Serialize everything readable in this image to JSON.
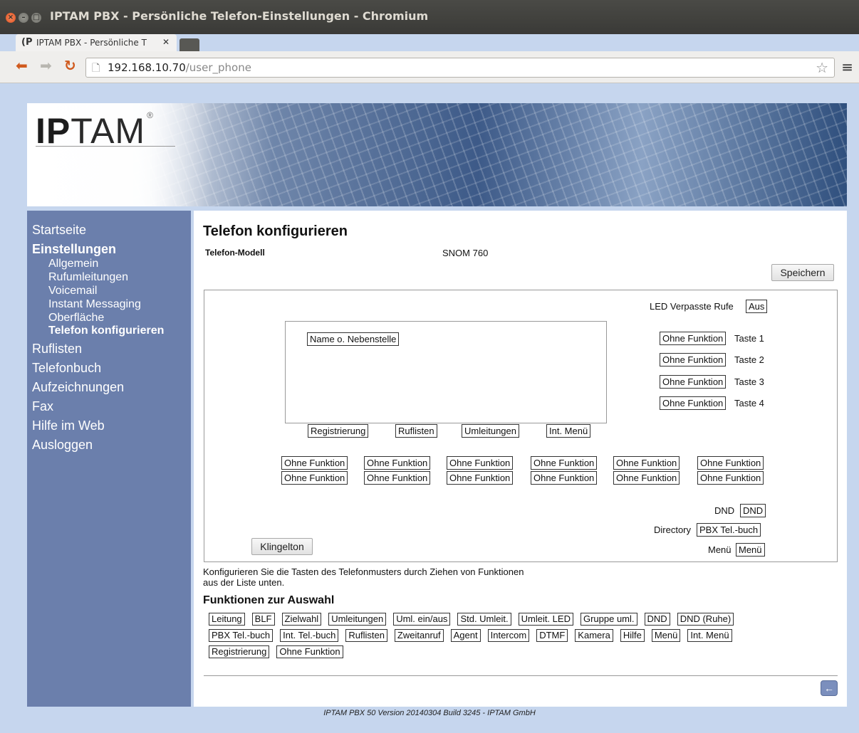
{
  "window": {
    "title": "IPTAM PBX - Persönliche Telefon-Einstellungen - Chromium"
  },
  "tab": {
    "favicon": "(P",
    "title": "IPTAM PBX - Persönliche T"
  },
  "browser": {
    "url_host": "192.168.10.70",
    "url_path": "/user_phone"
  },
  "logo": {
    "text_bold": "IP",
    "text_light": "TAM",
    "mark": "®"
  },
  "sidebar": {
    "items": [
      {
        "label": "Startseite"
      },
      {
        "label": "Einstellungen"
      },
      {
        "label": "Allgemein"
      },
      {
        "label": "Rufumleitungen"
      },
      {
        "label": "Voicemail"
      },
      {
        "label": "Instant Messaging"
      },
      {
        "label": "Oberfläche"
      },
      {
        "label": "Telefon konfigurieren"
      },
      {
        "label": "Ruflisten"
      },
      {
        "label": "Telefonbuch"
      },
      {
        "label": "Aufzeichnungen"
      },
      {
        "label": "Fax"
      },
      {
        "label": "Hilfe im Web"
      },
      {
        "label": "Ausloggen"
      }
    ]
  },
  "main": {
    "title": "Telefon konfigurieren",
    "model_label": "Telefon-Modell",
    "model_value": "SNOM 760",
    "save_label": "Speichern",
    "led_label": "LED Verpasste Rufe",
    "led_value": "Aus",
    "display_name": "Name o. Nebenstelle",
    "side_keys": [
      {
        "func": "Ohne Funktion",
        "label": "Taste 1"
      },
      {
        "func": "Ohne Funktion",
        "label": "Taste 2"
      },
      {
        "func": "Ohne Funktion",
        "label": "Taste 3"
      },
      {
        "func": "Ohne Funktion",
        "label": "Taste 4"
      }
    ],
    "soft_keys": [
      "Registrierung",
      "Ruflisten",
      "Umleitungen",
      "Int. Menü"
    ],
    "grid_keys": [
      "Ohne Funktion",
      "Ohne Funktion",
      "Ohne Funktion",
      "Ohne Funktion",
      "Ohne Funktion",
      "Ohne Funktion",
      "Ohne Funktion",
      "Ohne Funktion",
      "Ohne Funktion",
      "Ohne Funktion",
      "Ohne Funktion",
      "Ohne Funktion"
    ],
    "dnd_label": "DND",
    "dnd_value": "DND",
    "directory_label": "Directory",
    "directory_value": "PBX Tel.-buch",
    "menu_label": "Menü",
    "menu_value": "Menü",
    "ringtone_label": "Klingelton",
    "help_line1": "Konfigurieren Sie die Tasten des Telefonmusters durch Ziehen von Funktionen",
    "help_line2": "aus der Liste unten.",
    "functions_title": "Funktionen zur Auswahl",
    "functions": [
      "Leitung",
      "BLF",
      "Zielwahl",
      "Umleitungen",
      "Uml. ein/aus",
      "Std. Umleit.",
      "Umleit. LED",
      "Gruppe uml.",
      "DND",
      "DND (Ruhe)",
      "PBX Tel.-buch",
      "Int. Tel.-buch",
      "Ruflisten",
      "Zweitanruf",
      "Agent",
      "Intercom",
      "DTMF",
      "Kamera",
      "Hilfe",
      "Menü",
      "Int. Menü",
      "Registrierung",
      "Ohne Funktion"
    ]
  },
  "footer": {
    "text": "IPTAM PBX 50 Version 20140304 Build 3245 - IPTAM GmbH"
  },
  "icons": {
    "back": "arrow-left-icon",
    "star": "star-icon",
    "menu": "hamburger-icon",
    "reload": "reload-icon"
  }
}
